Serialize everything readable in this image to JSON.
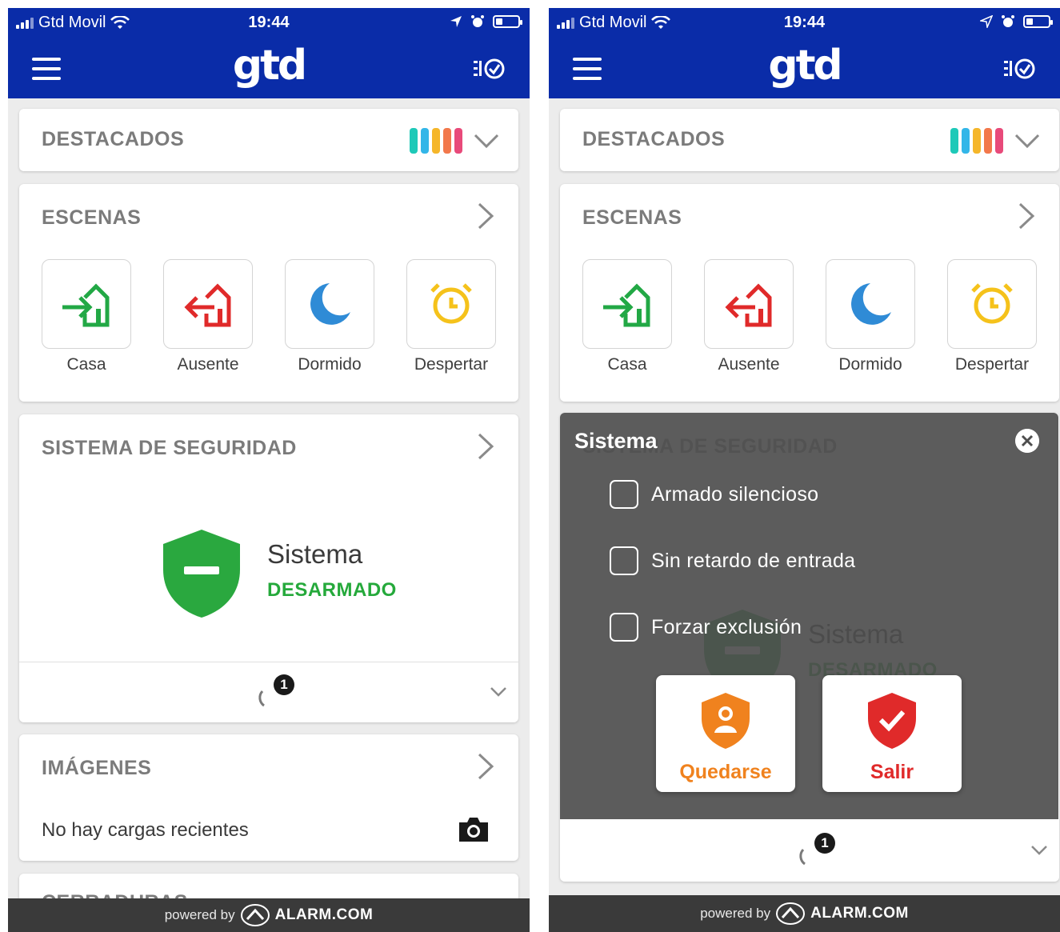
{
  "status_bar": {
    "carrier": "Gtd Movil",
    "time": "19:44"
  },
  "header": {
    "logo": "gtd"
  },
  "destacados": {
    "title": "DESTACADOS",
    "bar_colors": [
      "#1ec9b8",
      "#33b6e8",
      "#f5b62a",
      "#f2784b",
      "#e84a7a"
    ]
  },
  "escenas": {
    "title": "ESCENAS",
    "items": [
      {
        "label": "Casa",
        "icon": "home-enter-icon"
      },
      {
        "label": "Ausente",
        "icon": "home-exit-icon"
      },
      {
        "label": "Dormido",
        "icon": "moon-icon"
      },
      {
        "label": "Despertar",
        "icon": "alarm-clock-icon"
      }
    ]
  },
  "seguridad": {
    "title": "SISTEMA DE SEGURIDAD",
    "system_name": "Sistema",
    "system_state": "DESARMADO",
    "badge_count": "1"
  },
  "imagenes": {
    "title": "IMÁGENES",
    "empty_text": "No hay cargas recientes"
  },
  "cerraduras": {
    "title": "CERRADURAS"
  },
  "footer": {
    "powered": "powered by",
    "brand": "ALARM.COM"
  },
  "arm_dialog": {
    "title": "Sistema",
    "options": [
      "Armado silencioso",
      "Sin retardo de entrada",
      "Forzar exclusión"
    ],
    "stay_label": "Quedarse",
    "away_label": "Salir"
  },
  "colors": {
    "brand_blue": "#0a2ca8",
    "disarmed_green": "#25a93b",
    "stay_orange": "#f0821e",
    "away_red": "#e02a2a"
  }
}
